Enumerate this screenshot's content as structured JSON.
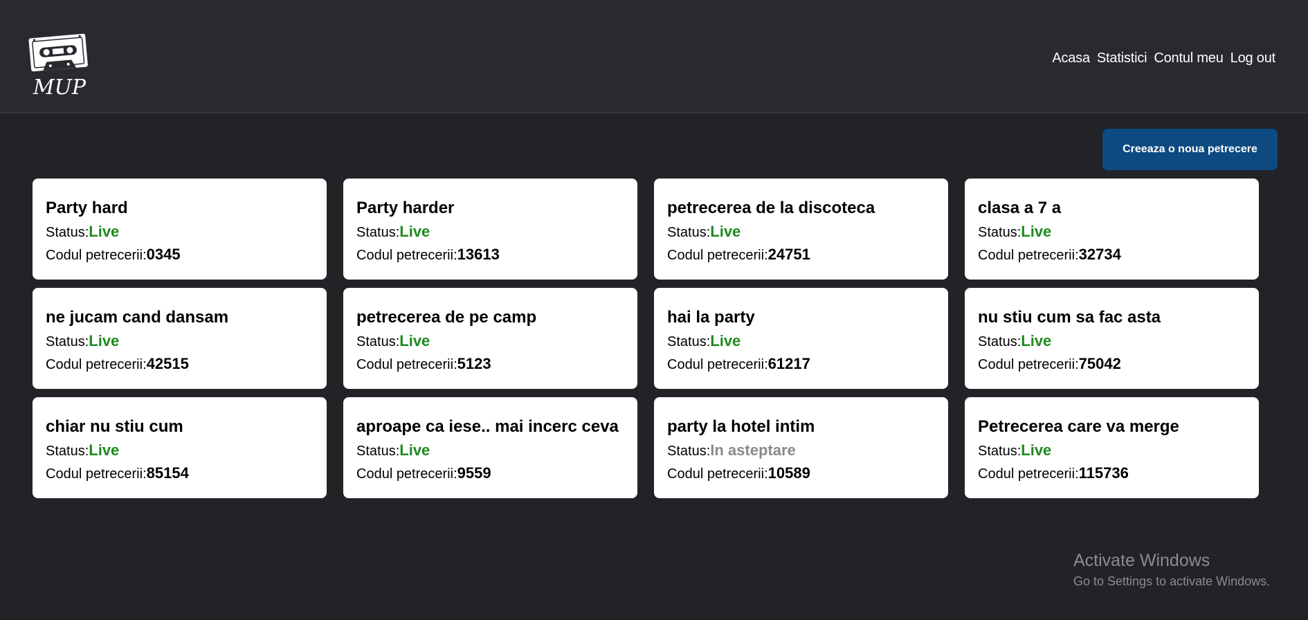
{
  "header": {
    "logo_text": "MUP",
    "nav": [
      "Acasa",
      "Statistici",
      "Contul meu",
      "Log out"
    ]
  },
  "create_button_label": "Creeaza o noua petrecere",
  "labels": {
    "status": "Status:",
    "code": "Codul petrecerii:"
  },
  "parties": [
    {
      "name": "Party hard",
      "status": "Live",
      "code": "0345"
    },
    {
      "name": "Party harder",
      "status": "Live",
      "code": "13613"
    },
    {
      "name": "petrecerea de la discoteca",
      "status": "Live",
      "code": "24751"
    },
    {
      "name": "clasa a 7 a",
      "status": "Live",
      "code": "32734"
    },
    {
      "name": "ne jucam cand dansam",
      "status": "Live",
      "code": "42515"
    },
    {
      "name": "petrecerea de pe camp",
      "status": "Live",
      "code": "5123"
    },
    {
      "name": "hai la party",
      "status": "Live",
      "code": "61217"
    },
    {
      "name": "nu stiu cum sa fac asta",
      "status": "Live",
      "code": "75042"
    },
    {
      "name": "chiar nu stiu cum",
      "status": "Live",
      "code": "85154"
    },
    {
      "name": "aproape ca iese.. mai incerc ceva",
      "status": "Live",
      "code": "9559"
    },
    {
      "name": "party la hotel intim",
      "status": "In asteptare",
      "code": "10589"
    },
    {
      "name": "Petrecerea care va merge",
      "status": "Live",
      "code": "115736"
    }
  ],
  "watermark": {
    "title": "Activate Windows",
    "subtitle": "Go to Settings to activate Windows."
  },
  "colors": {
    "background": "#212327",
    "header": "#282a2f",
    "button": "#0d4a82",
    "status_live": "#1e8a1e",
    "status_waiting": "#8a8a8a"
  }
}
